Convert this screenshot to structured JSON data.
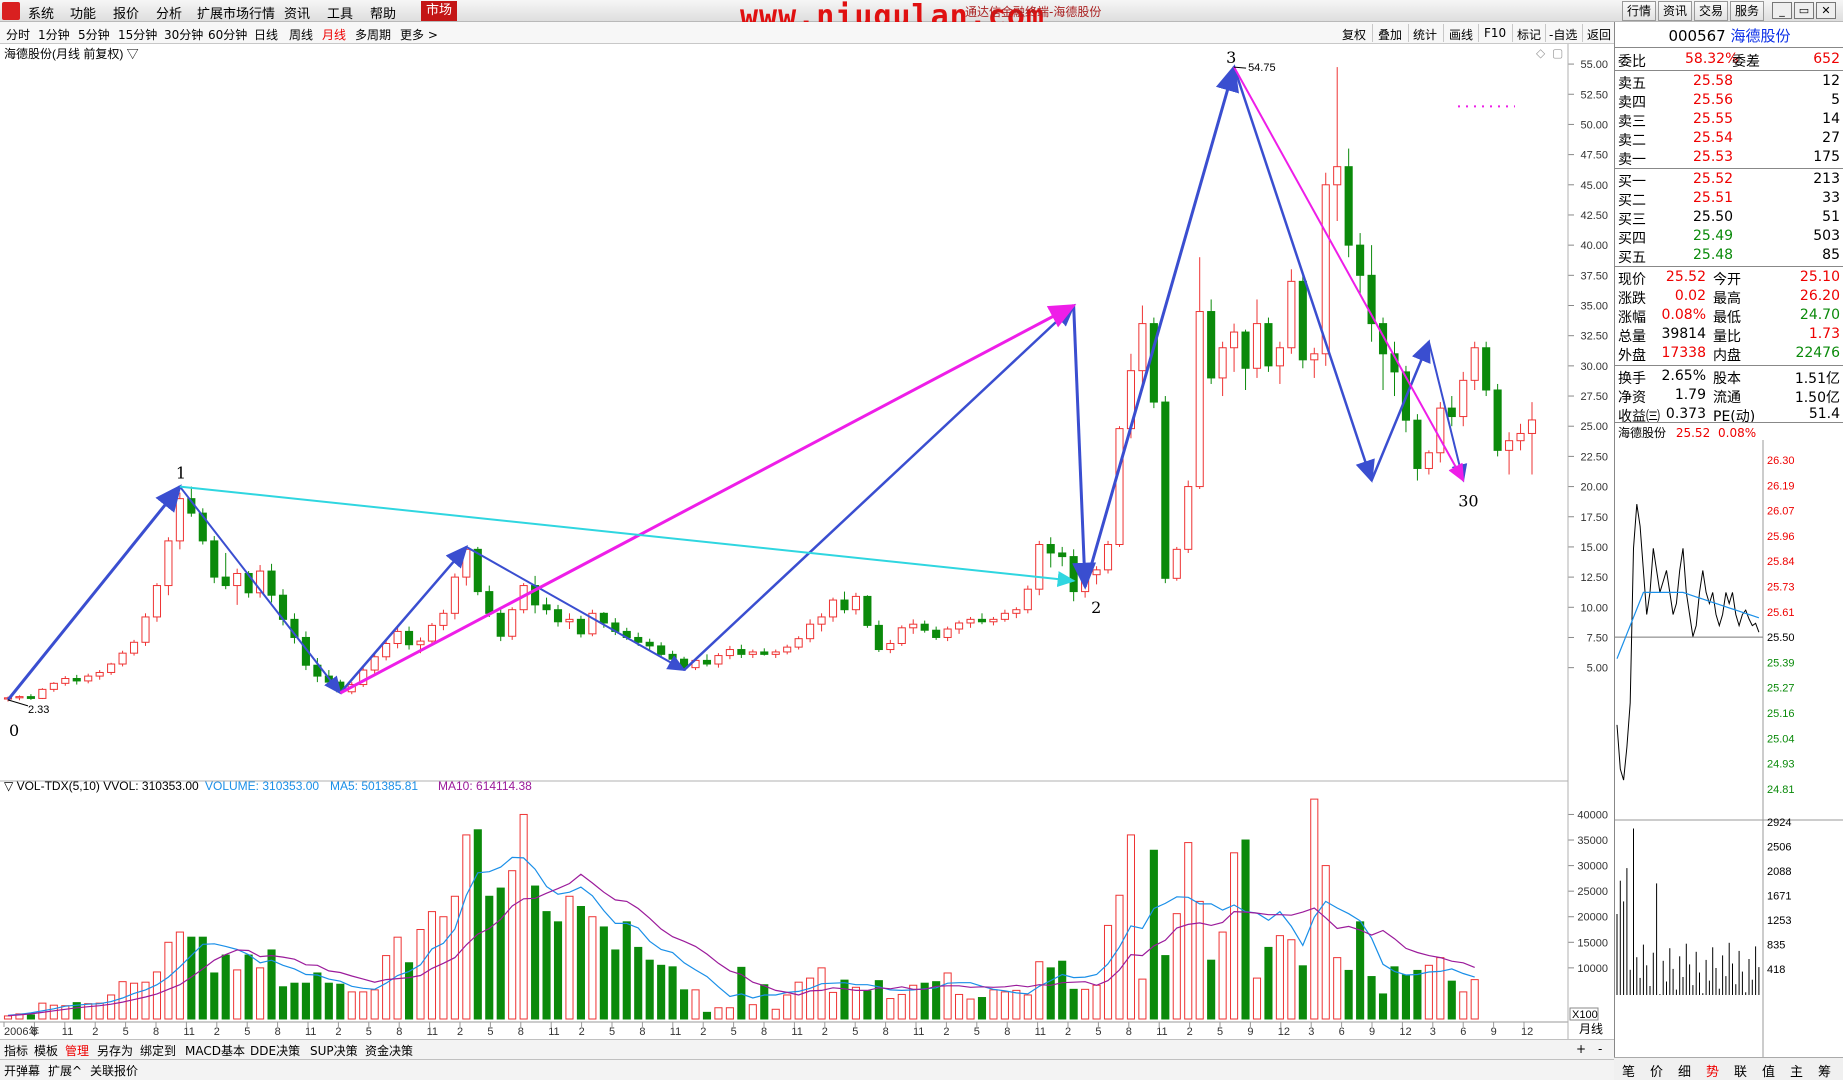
{
  "menubar": {
    "items": [
      "系统",
      "功能",
      "报价",
      "分析",
      "扩展市场行情",
      "资讯",
      "工具",
      "帮助"
    ],
    "active_item": "市场",
    "watermark": "www.niugulan.com",
    "subtitle": "通达信金融终端-海德股份",
    "right_buttons": [
      "行情",
      "资讯",
      "交易",
      "服务"
    ]
  },
  "timeframes": [
    "分时",
    "1分钟",
    "5分钟",
    "15分钟",
    "30分钟",
    "60分钟",
    "日线",
    "周线",
    "月线",
    "多周期",
    "更多 >"
  ],
  "active_timeframe": "月线",
  "tools": [
    "复权",
    "叠加",
    "统计",
    "画线",
    "F10",
    "标记",
    "-自选",
    "返回"
  ],
  "chart_title": "海德股份(月线 前复权) ▽",
  "indicator_line": {
    "name": "▽ VOL-TDX(5,10) VVOL: 310353.00",
    "volume": "VOLUME: 310353.00",
    "ma5": "MA5: 501385.81",
    "ma10": "MA10: 614114.38"
  },
  "price_axis": [
    "55.00",
    "52.50",
    "50.00",
    "47.50",
    "45.00",
    "42.50",
    "40.00",
    "37.50",
    "35.00",
    "32.50",
    "30.00",
    "27.50",
    "25.00",
    "22.50",
    "20.00",
    "17.50",
    "15.00",
    "12.50",
    "10.00",
    "7.50",
    "5.00"
  ],
  "vol_axis": [
    "40000",
    "35000",
    "30000",
    "25000",
    "20000",
    "15000",
    "10000"
  ],
  "vol_unit": "X100",
  "x_axis": {
    "labels": [
      "2006年",
      "8",
      "11",
      "2",
      "5",
      "8",
      "11",
      "2",
      "5",
      "8",
      "11",
      "2",
      "5",
      "8",
      "11",
      "2",
      "5",
      "8",
      "11",
      "2",
      "5",
      "8",
      "11",
      "2",
      "5",
      "8",
      "11",
      "2",
      "5",
      "8",
      "11",
      "2",
      "5",
      "8",
      "11",
      "2",
      "5",
      "8",
      "11",
      "2",
      "5",
      "9",
      "12",
      "3",
      "6",
      "9",
      "12",
      "3",
      "6",
      "9",
      "12"
    ],
    "period": "月线"
  },
  "wave_labels": {
    "p0": "0",
    "p1": "1",
    "p2": "2",
    "p3": "3",
    "p30": "30",
    "low": "2.33",
    "high": "54.75"
  },
  "chart_data": {
    "type": "candlestick",
    "title": "海德股份(月线 前复权)",
    "ylim": [
      0,
      56
    ],
    "colors": {
      "up": "#ee3333",
      "down": "#0b8a0b",
      "wave_blue": "#3a4ed0",
      "wave_magenta": "#ee1ee8",
      "wave_cyan": "#2fd6e0",
      "ma5": "#1a8fe8",
      "ma10": "#9b1b9b"
    },
    "candles": [
      [
        2.4,
        2.6,
        2.2,
        2.5
      ],
      [
        2.5,
        2.7,
        2.3,
        2.6
      ],
      [
        2.6,
        2.8,
        2.33,
        2.45
      ],
      [
        2.45,
        3.3,
        2.4,
        3.2
      ],
      [
        3.2,
        3.8,
        3.0,
        3.7
      ],
      [
        3.7,
        4.3,
        3.5,
        4.1
      ],
      [
        4.1,
        4.4,
        3.6,
        3.9
      ],
      [
        3.9,
        4.5,
        3.7,
        4.3
      ],
      [
        4.3,
        4.8,
        4.0,
        4.6
      ],
      [
        4.6,
        5.4,
        4.4,
        5.3
      ],
      [
        5.3,
        6.4,
        5.1,
        6.2
      ],
      [
        6.2,
        7.3,
        6.0,
        7.1
      ],
      [
        7.1,
        9.5,
        6.8,
        9.2
      ],
      [
        9.2,
        12.0,
        8.8,
        11.8
      ],
      [
        11.8,
        15.8,
        11.0,
        15.5
      ],
      [
        15.5,
        19.5,
        14.8,
        19.0
      ],
      [
        19.0,
        20.0,
        17.5,
        17.8
      ],
      [
        17.8,
        18.2,
        15.2,
        15.5
      ],
      [
        15.5,
        15.9,
        12.0,
        12.5
      ],
      [
        12.5,
        14.5,
        11.5,
        11.8
      ],
      [
        11.8,
        13.2,
        10.2,
        12.8
      ],
      [
        12.8,
        13.0,
        10.8,
        11.2
      ],
      [
        11.2,
        13.5,
        10.8,
        13.0
      ],
      [
        13.0,
        13.6,
        10.4,
        11.0
      ],
      [
        11.0,
        11.5,
        8.5,
        9.0
      ],
      [
        9.0,
        9.5,
        7.0,
        7.5
      ],
      [
        7.5,
        8.0,
        4.8,
        5.2
      ],
      [
        5.2,
        5.8,
        3.8,
        4.3
      ],
      [
        4.3,
        4.8,
        3.4,
        3.8
      ],
      [
        3.8,
        4.0,
        2.9,
        3.0
      ],
      [
        3.0,
        3.8,
        2.8,
        3.6
      ],
      [
        3.6,
        5.0,
        3.4,
        4.8
      ],
      [
        4.8,
        6.2,
        4.5,
        5.9
      ],
      [
        5.9,
        7.3,
        5.6,
        7.0
      ],
      [
        7.0,
        8.3,
        6.6,
        8.0
      ],
      [
        8.0,
        8.4,
        6.5,
        6.9
      ],
      [
        6.9,
        7.5,
        6.2,
        7.2
      ],
      [
        7.2,
        8.7,
        6.9,
        8.5
      ],
      [
        8.5,
        9.8,
        8.1,
        9.5
      ],
      [
        9.5,
        12.8,
        9.0,
        12.5
      ],
      [
        12.5,
        15.0,
        11.8,
        14.8
      ],
      [
        14.8,
        15.0,
        11.0,
        11.3
      ],
      [
        11.3,
        11.8,
        9.2,
        9.5
      ],
      [
        9.5,
        9.8,
        7.2,
        7.6
      ],
      [
        7.6,
        10.0,
        7.3,
        9.8
      ],
      [
        9.8,
        12.0,
        9.5,
        11.8
      ],
      [
        11.8,
        12.6,
        9.5,
        10.2
      ],
      [
        10.2,
        10.8,
        9.4,
        9.8
      ],
      [
        9.8,
        10.2,
        8.4,
        8.8
      ],
      [
        8.8,
        9.5,
        8.2,
        9.0
      ],
      [
        9.0,
        9.3,
        7.5,
        7.8
      ],
      [
        7.8,
        9.8,
        7.6,
        9.5
      ],
      [
        9.5,
        9.6,
        8.3,
        8.7
      ],
      [
        8.7,
        9.1,
        7.7,
        8.0
      ],
      [
        8.0,
        8.3,
        7.3,
        7.5
      ],
      [
        7.5,
        7.9,
        6.8,
        7.1
      ],
      [
        7.1,
        7.4,
        6.5,
        6.8
      ],
      [
        6.8,
        7.1,
        5.8,
        6.1
      ],
      [
        6.1,
        6.4,
        5.5,
        5.7
      ],
      [
        5.7,
        5.9,
        4.8,
        5.0
      ],
      [
        5.0,
        5.8,
        4.8,
        5.6
      ],
      [
        5.6,
        6.1,
        5.1,
        5.3
      ],
      [
        5.3,
        6.2,
        5.0,
        6.0
      ],
      [
        6.0,
        6.8,
        5.7,
        6.5
      ],
      [
        6.5,
        6.9,
        5.8,
        6.1
      ],
      [
        6.1,
        6.5,
        5.8,
        6.3
      ],
      [
        6.3,
        6.6,
        6.0,
        6.1
      ],
      [
        6.1,
        6.5,
        5.8,
        6.3
      ],
      [
        6.3,
        6.9,
        6.1,
        6.7
      ],
      [
        6.7,
        7.6,
        6.5,
        7.4
      ],
      [
        7.4,
        9.0,
        7.1,
        8.6
      ],
      [
        8.6,
        9.5,
        8.0,
        9.2
      ],
      [
        9.2,
        10.8,
        8.8,
        10.6
      ],
      [
        10.6,
        11.3,
        9.5,
        9.8
      ],
      [
        9.8,
        11.2,
        9.4,
        10.9
      ],
      [
        10.9,
        11.0,
        8.3,
        8.5
      ],
      [
        8.5,
        8.9,
        6.3,
        6.5
      ],
      [
        6.5,
        7.3,
        6.2,
        7.0
      ],
      [
        7.0,
        8.5,
        6.8,
        8.3
      ],
      [
        8.3,
        9.0,
        7.8,
        8.6
      ],
      [
        8.6,
        8.9,
        7.9,
        8.1
      ],
      [
        8.1,
        8.4,
        7.3,
        7.5
      ],
      [
        7.5,
        8.4,
        7.2,
        8.2
      ],
      [
        8.2,
        8.9,
        7.8,
        8.7
      ],
      [
        8.7,
        9.2,
        8.3,
        9.0
      ],
      [
        9.0,
        9.5,
        8.6,
        8.8
      ],
      [
        8.8,
        9.2,
        8.5,
        9.0
      ],
      [
        9.0,
        9.8,
        8.8,
        9.5
      ],
      [
        9.5,
        10.0,
        9.1,
        9.8
      ],
      [
        9.8,
        11.8,
        9.5,
        11.5
      ],
      [
        11.5,
        15.5,
        11.0,
        15.2
      ],
      [
        15.2,
        15.8,
        13.3,
        14.5
      ],
      [
        14.5,
        15.0,
        13.4,
        14.2
      ],
      [
        14.2,
        14.8,
        10.5,
        11.3
      ],
      [
        11.3,
        13.0,
        10.8,
        12.7
      ],
      [
        12.7,
        13.4,
        11.9,
        13.1
      ],
      [
        13.1,
        15.5,
        12.8,
        15.2
      ],
      [
        15.2,
        25.0,
        15.0,
        24.8
      ],
      [
        24.8,
        31.0,
        24.0,
        29.6
      ],
      [
        29.6,
        35.0,
        28.0,
        33.5
      ],
      [
        33.5,
        34.0,
        26.5,
        27.0
      ],
      [
        27.0,
        27.5,
        12.0,
        12.4
      ],
      [
        12.4,
        15.0,
        12.2,
        14.8
      ],
      [
        14.8,
        20.5,
        14.5,
        20.0
      ],
      [
        20.0,
        39.0,
        19.8,
        34.5
      ],
      [
        34.5,
        35.5,
        28.5,
        29.0
      ],
      [
        29.0,
        32.0,
        27.5,
        31.5
      ],
      [
        31.5,
        33.5,
        29.5,
        32.8
      ],
      [
        32.8,
        33.0,
        28.0,
        29.8
      ],
      [
        29.8,
        35.5,
        29.0,
        33.5
      ],
      [
        33.5,
        34.0,
        29.5,
        30.0
      ],
      [
        30.0,
        32.0,
        28.5,
        31.5
      ],
      [
        31.5,
        38.0,
        31.0,
        37.0
      ],
      [
        37.0,
        37.5,
        29.8,
        30.5
      ],
      [
        30.5,
        31.5,
        29.0,
        31.0
      ],
      [
        31.0,
        46.0,
        30.0,
        45.0
      ],
      [
        45.0,
        54.75,
        42.0,
        46.5
      ],
      [
        46.5,
        48.0,
        39.0,
        40.0
      ],
      [
        40.0,
        41.0,
        36.0,
        37.5
      ],
      [
        37.5,
        40.0,
        32.0,
        33.5
      ],
      [
        33.5,
        34.0,
        28.0,
        31.0
      ],
      [
        31.0,
        32.0,
        27.5,
        29.5
      ],
      [
        29.5,
        30.0,
        24.5,
        25.5
      ],
      [
        25.5,
        26.0,
        20.5,
        21.5
      ],
      [
        21.5,
        23.0,
        21.0,
        22.8
      ],
      [
        22.8,
        27.0,
        22.0,
        26.5
      ],
      [
        26.5,
        27.5,
        25.0,
        25.8
      ],
      [
        25.8,
        29.5,
        25.0,
        28.8
      ],
      [
        28.8,
        32.0,
        28.0,
        31.5
      ],
      [
        31.5,
        32.0,
        27.5,
        28.0
      ],
      [
        28.0,
        28.5,
        22.5,
        23.0
      ],
      [
        23.0,
        24.5,
        21.0,
        23.8
      ],
      [
        23.8,
        25.2,
        23.0,
        24.4
      ],
      [
        24.4,
        27.0,
        21.0,
        25.52
      ]
    ],
    "volume": [
      600,
      1000,
      800,
      3100,
      2700,
      2600,
      3200,
      3000,
      3100,
      4700,
      7300,
      7000,
      7200,
      9200,
      15000,
      17000,
      16000,
      16000,
      9000,
      12500,
      9600,
      12500,
      10000,
      13500,
      6300,
      7000,
      7000,
      9000,
      7000,
      6800,
      5300,
      5300,
      5700,
      12400,
      16000,
      11000,
      17500,
      21000,
      20000,
      24000,
      36000,
      37000,
      24000,
      25600,
      29000,
      40000,
      26000,
      21000,
      19000,
      24000,
      22000,
      20000,
      18000,
      13500,
      19000,
      14000,
      11500,
      10500,
      10200,
      5700,
      5700,
      1300,
      2200,
      2200,
      10100,
      2800,
      6700,
      1900,
      4700,
      7200,
      8000,
      10000,
      5200,
      7600,
      6200,
      5500,
      7500,
      4000,
      4800,
      6600,
      7000,
      7300,
      9000,
      4800,
      3900,
      4200,
      5700,
      5300,
      5600,
      4700,
      11200,
      10000,
      11300,
      5800,
      5800,
      6600,
      18300,
      24200,
      36000,
      7800,
      33000,
      12400,
      20600,
      34500,
      23000,
      11500,
      17000,
      32500,
      35000,
      8000,
      14000,
      16300,
      15500,
      10400,
      43000,
      30000,
      12000,
      9500,
      19000,
      8300,
      4900,
      10200,
      8600,
      9500,
      10500,
      12000,
      7400,
      5300,
      7700
    ],
    "ma5": [
      700,
      900,
      1200,
      1600,
      2000,
      2500,
      2700,
      2900,
      3000,
      3400,
      4100,
      5000,
      5700,
      6700,
      8200,
      10200,
      12400,
      14600,
      14700,
      14200,
      13600,
      12600,
      11000,
      11500,
      10500,
      9800,
      8700,
      8600,
      7800,
      7400,
      6400,
      6000,
      5800,
      7000,
      8500,
      9300,
      10600,
      13700,
      14800,
      17600,
      24200,
      28600,
      28800,
      29700,
      31600,
      31500,
      29300,
      25900,
      24400,
      24800,
      25800,
      24100,
      21200,
      18700,
      18700,
      17800,
      15200,
      13600,
      13000,
      11000,
      9600,
      8300,
      6300,
      4400,
      4900,
      4100,
      4700,
      4700,
      5200,
      5400,
      6000,
      6900,
      7000,
      7100,
      6700,
      6700,
      6300,
      5700,
      5600,
      5700,
      5900,
      6100,
      7000,
      7100,
      7100,
      6400,
      5800,
      5500,
      5100,
      4900,
      6400,
      7500,
      8700,
      8100,
      8200,
      8700,
      10800,
      14100,
      18200,
      17700,
      21600,
      22600,
      23900,
      23800,
      22500,
      22500,
      21300,
      22300,
      21000,
      20700,
      19300,
      21000,
      18100,
      14400,
      19900,
      23000,
      21700,
      20600,
      19200,
      15800,
      10700,
      9300,
      8600,
      8700,
      9200,
      9300,
      9800,
      8900,
      8200
    ],
    "ma10": [
      650,
      800,
      1000,
      1300,
      1600,
      1900,
      2200,
      2400,
      2600,
      2900,
      3300,
      3800,
      4300,
      4900,
      5800,
      6700,
      8200,
      9800,
      11500,
      12600,
      13500,
      13400,
      12200,
      12400,
      12100,
      11700,
      10600,
      10500,
      9400,
      9100,
      8400,
      7800,
      7200,
      7700,
      7900,
      8100,
      8500,
      9900,
      10900,
      12000,
      14500,
      16600,
      17700,
      19500,
      22100,
      23500,
      23600,
      24600,
      25500,
      26500,
      28300,
      26600,
      24800,
      23300,
      23000,
      21600,
      19700,
      17600,
      16100,
      15200,
      14200,
      12700,
      10900,
      9400,
      8700,
      7200,
      6500,
      5600,
      5200,
      4700,
      5500,
      5600,
      6100,
      5900,
      5600,
      5600,
      6100,
      5900,
      6300,
      5800,
      5800,
      6400,
      6500,
      6500,
      6200,
      6300,
      6200,
      6300,
      6600,
      6300,
      6700,
      6600,
      7100,
      7200,
      7300,
      6600,
      7500,
      9600,
      12600,
      12400,
      14300,
      15400,
      17800,
      18500,
      18800,
      18300,
      18900,
      21000,
      20900,
      20700,
      20400,
      20400,
      20300,
      20900,
      21700,
      19800,
      17700,
      18100,
      17400,
      16400,
      17300,
      15700,
      13800,
      13000,
      12400,
      12000,
      11300,
      11000,
      10100
    ]
  },
  "quote_panel": {
    "code": "000567",
    "name": "海德股份",
    "webi_label": "委比",
    "webi": "58.32%",
    "weicha_label": "委差",
    "weicha": "652",
    "sells": [
      [
        "卖五",
        "25.58",
        "12"
      ],
      [
        "卖四",
        "25.56",
        "5"
      ],
      [
        "卖三",
        "25.55",
        "14"
      ],
      [
        "卖二",
        "25.54",
        "27"
      ],
      [
        "卖一",
        "25.53",
        "175"
      ]
    ],
    "buys": [
      [
        "买一",
        "25.52",
        "213"
      ],
      [
        "买二",
        "25.51",
        "33"
      ],
      [
        "买三",
        "25.50",
        "51"
      ],
      [
        "买四",
        "25.49",
        "503"
      ],
      [
        "买五",
        "25.48",
        "85"
      ]
    ],
    "stats": [
      [
        "现价",
        "25.52",
        "今开",
        "25.10"
      ],
      [
        "涨跌",
        "0.02",
        "最高",
        "26.20"
      ],
      [
        "涨幅",
        "0.08%",
        "最低",
        "24.70"
      ],
      [
        "总量",
        "39814",
        "量比",
        "1.73"
      ],
      [
        "外盘",
        "17338",
        "内盘",
        "22476"
      ],
      [
        "换手",
        "2.65%",
        "股本",
        "1.51亿"
      ],
      [
        "净资",
        "1.79",
        "流通",
        "1.50亿"
      ],
      [
        "收益㈢",
        "0.373",
        "PE(动)",
        "51.4"
      ]
    ],
    "mini_title": "海德股份",
    "mini_price": "25.52",
    "mini_pct": "0.08%",
    "mini_axis": [
      "26.30",
      "26.19",
      "26.07",
      "25.96",
      "25.84",
      "25.73",
      "25.61",
      "25.50",
      "25.39",
      "25.27",
      "25.16",
      "25.04",
      "24.93",
      "24.81"
    ],
    "mini_vol_axis": [
      "2924",
      "2506",
      "2088",
      "1671",
      "1253",
      "835",
      "418"
    ],
    "tabs": [
      "笔",
      "价",
      "细",
      "势",
      "联",
      "值",
      "主",
      "筹"
    ],
    "active_tab": "势"
  },
  "bottom_tabs1": [
    "指标",
    "模板",
    "管理",
    "另存为",
    "绑定到",
    "MACD基本",
    "DDE决策",
    "SUP决策",
    "资金决策"
  ],
  "bottom_tabs1_active": "管理",
  "bottom_tabs2": [
    "开弹幕",
    "扩展^",
    "关联报价"
  ],
  "bottom_right": [
    "月线",
    "+",
    "-"
  ]
}
